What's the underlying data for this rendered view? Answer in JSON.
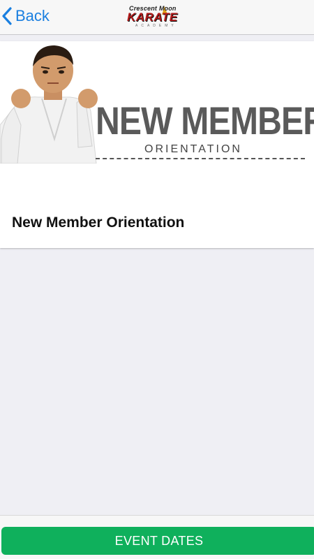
{
  "navbar": {
    "back_label": "Back",
    "logo": {
      "line1": "Crescent Moon",
      "line2": "KARATE",
      "line3": "ACADEMY"
    }
  },
  "card": {
    "banner": {
      "headline": "NEW MEMBER",
      "subline": "ORIENTATION"
    },
    "title": "New Member Orientation"
  },
  "bottom": {
    "event_dates_label": "EVENT DATES"
  },
  "colors": {
    "accent_blue": "#1a7fe0",
    "button_green": "#0fb05c",
    "background": "#efeff4"
  }
}
